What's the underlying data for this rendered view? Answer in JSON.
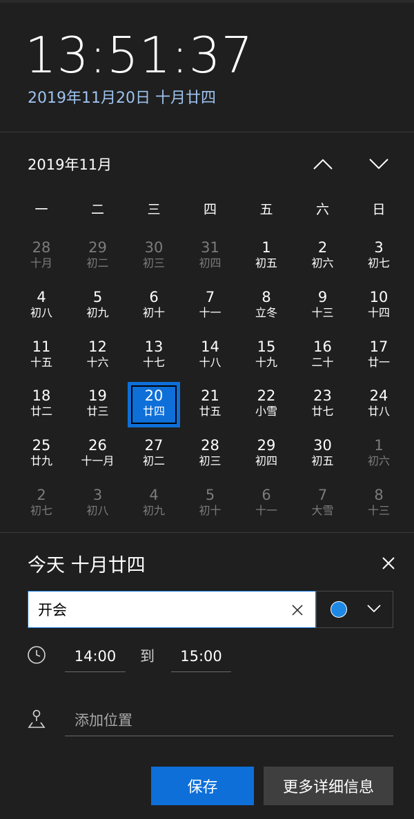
{
  "clock": {
    "time": "13:51:37",
    "date": "2019年11月20日 十月廿四"
  },
  "calendar": {
    "month_label": "2019年11月",
    "weekdays": [
      "一",
      "二",
      "三",
      "四",
      "五",
      "六",
      "日"
    ],
    "weeks": [
      [
        {
          "day": "28",
          "lunar": "十月",
          "other": true
        },
        {
          "day": "29",
          "lunar": "初二",
          "other": true
        },
        {
          "day": "30",
          "lunar": "初三",
          "other": true
        },
        {
          "day": "31",
          "lunar": "初四",
          "other": true
        },
        {
          "day": "1",
          "lunar": "初五"
        },
        {
          "day": "2",
          "lunar": "初六"
        },
        {
          "day": "3",
          "lunar": "初七"
        }
      ],
      [
        {
          "day": "4",
          "lunar": "初八"
        },
        {
          "day": "5",
          "lunar": "初九"
        },
        {
          "day": "6",
          "lunar": "初十"
        },
        {
          "day": "7",
          "lunar": "十一"
        },
        {
          "day": "8",
          "lunar": "立冬"
        },
        {
          "day": "9",
          "lunar": "十三"
        },
        {
          "day": "10",
          "lunar": "十四"
        }
      ],
      [
        {
          "day": "11",
          "lunar": "十五"
        },
        {
          "day": "12",
          "lunar": "十六"
        },
        {
          "day": "13",
          "lunar": "十七"
        },
        {
          "day": "14",
          "lunar": "十八"
        },
        {
          "day": "15",
          "lunar": "十九"
        },
        {
          "day": "16",
          "lunar": "二十"
        },
        {
          "day": "17",
          "lunar": "廿一"
        }
      ],
      [
        {
          "day": "18",
          "lunar": "廿二"
        },
        {
          "day": "19",
          "lunar": "廿三"
        },
        {
          "day": "20",
          "lunar": "廿四",
          "today": true
        },
        {
          "day": "21",
          "lunar": "廿五"
        },
        {
          "day": "22",
          "lunar": "小雪"
        },
        {
          "day": "23",
          "lunar": "廿七"
        },
        {
          "day": "24",
          "lunar": "廿八"
        }
      ],
      [
        {
          "day": "25",
          "lunar": "廿九"
        },
        {
          "day": "26",
          "lunar": "十一月"
        },
        {
          "day": "27",
          "lunar": "初二"
        },
        {
          "day": "28",
          "lunar": "初三"
        },
        {
          "day": "29",
          "lunar": "初四"
        },
        {
          "day": "30",
          "lunar": "初五"
        },
        {
          "day": "1",
          "lunar": "初六",
          "other": true
        }
      ],
      [
        {
          "day": "2",
          "lunar": "初七",
          "other": true
        },
        {
          "day": "3",
          "lunar": "初八",
          "other": true
        },
        {
          "day": "4",
          "lunar": "初九",
          "other": true
        },
        {
          "day": "5",
          "lunar": "初十",
          "other": true
        },
        {
          "day": "6",
          "lunar": "十一",
          "other": true
        },
        {
          "day": "7",
          "lunar": "大雪",
          "other": true
        },
        {
          "day": "8",
          "lunar": "十三",
          "other": true
        }
      ]
    ]
  },
  "event": {
    "title": "今天 十月廿四",
    "name_value": "开会",
    "color": "#1e88e5",
    "start_time": "14:00",
    "to_label": "到",
    "end_time": "15:00",
    "location_placeholder": "添加位置"
  },
  "buttons": {
    "save": "保存",
    "more_details": "更多详细信息"
  },
  "icons": [
    "chevron-up-icon",
    "chevron-down-icon",
    "close-icon",
    "clear-icon",
    "clock-icon",
    "location-pin-icon"
  ]
}
